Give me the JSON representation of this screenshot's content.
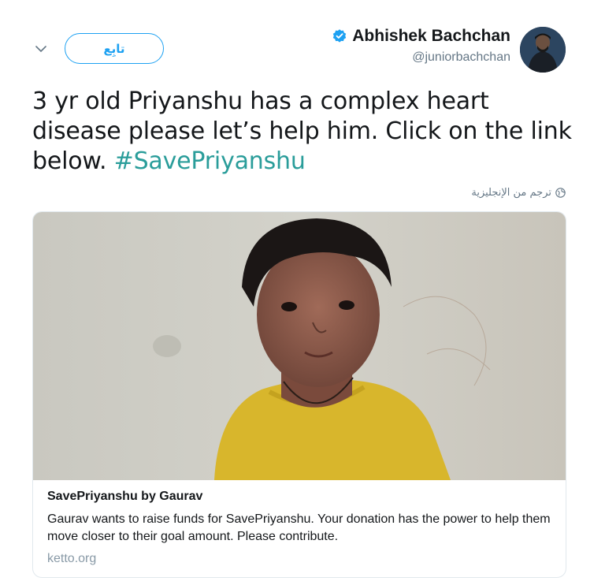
{
  "header": {
    "follow_label": "تابِع",
    "author_name": "Abhishek Bachchan",
    "handle": "@juniorbachchan"
  },
  "tweet": {
    "text_before_hashtag": "3 yr old Priyanshu has a complex heart disease please let’s help him. Click on the link below. ",
    "hashtag": "#SavePriyanshu",
    "translate_label": "ترجم من الإنجليزية"
  },
  "card": {
    "title": "SavePriyanshu by Gaurav",
    "description": "Gaurav wants to raise funds for SavePriyanshu. Your donation has the power to help them move closer to their goal amount. Please contribute.",
    "domain": "ketto.org"
  },
  "icons": {
    "caret": "chevron-down-icon",
    "verified": "verified-badge-icon",
    "globe": "globe-icon"
  },
  "colors": {
    "accent": "#1da1f2",
    "hashtag": "#2a9d9a",
    "secondary_text": "#657786"
  }
}
